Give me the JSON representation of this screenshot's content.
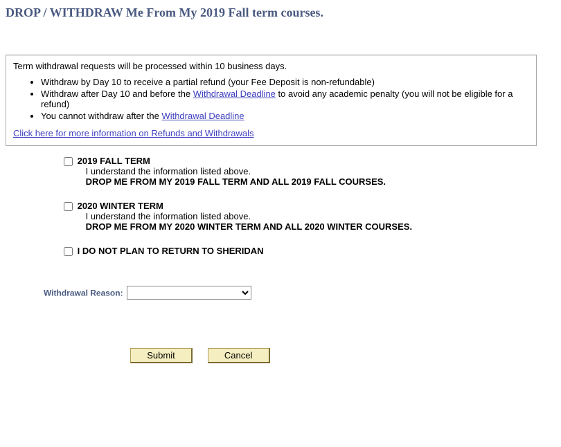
{
  "title": "DROP / WITHDRAW Me From My 2019 Fall term courses.",
  "info": {
    "lead": "Term withdrawal requests will be processed within 10 business days.",
    "bullets": [
      {
        "pre": "Withdraw by Day 10 to receive a partial refund (your Fee Deposit is non-refundable)"
      },
      {
        "pre": "Withdraw after Day 10 and before the ",
        "link": "Withdrawal Deadline",
        "post": " to avoid any academic penalty (you will not be eligible for a refund)"
      },
      {
        "pre": "You cannot withdraw after the ",
        "link": "Withdrawal Deadline"
      }
    ],
    "more_link": "Click here for more information on Refunds and Withdrawals"
  },
  "options": {
    "fall": {
      "term": "2019 FALL TERM",
      "understand": "I understand the information listed above.",
      "drop": "DROP ME FROM MY 2019 FALL TERM AND ALL 2019 FALL COURSES."
    },
    "winter": {
      "term": "2020 WINTER TERM",
      "understand": "I understand the information listed above.",
      "drop": "DROP ME FROM MY 2020 WINTER TERM AND ALL 2020 WINTER COURSES."
    },
    "noreturn": "I DO NOT PLAN TO RETURN TO SHERIDAN"
  },
  "reason_label": "Withdrawal Reason:",
  "buttons": {
    "submit": "Submit",
    "cancel": "Cancel"
  }
}
